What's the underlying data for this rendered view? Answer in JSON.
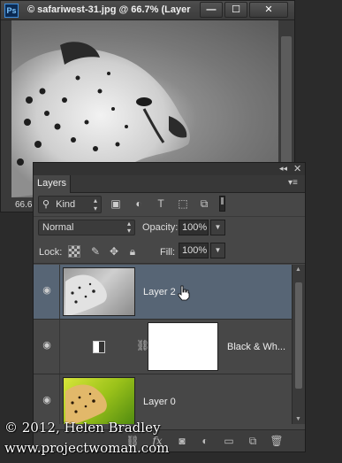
{
  "document": {
    "app_badge": "Ps",
    "title": "© safariwest-31.jpg @ 66.7% (Layer",
    "controls": {
      "minimize": "—",
      "maximize": "☐",
      "close": "✕"
    },
    "zoom_level": "66.6"
  },
  "layers_panel": {
    "tab_label": "Layers",
    "filter": {
      "kind_label": "Kind"
    },
    "blend": {
      "mode": "Normal",
      "opacity_label": "Opacity:",
      "opacity_value": "100%"
    },
    "lock": {
      "label": "Lock:",
      "fill_label": "Fill:",
      "fill_value": "100%"
    },
    "layers": [
      {
        "name": "Layer 2",
        "selected": true,
        "visible": true,
        "thumb": "cheetah-gray"
      },
      {
        "name": "Black & Wh...",
        "selected": false,
        "visible": true,
        "thumb": "adjustment-mask"
      },
      {
        "name": "Layer 0",
        "selected": false,
        "visible": true,
        "thumb": "cheetah-color"
      }
    ],
    "footer_icons": [
      "link-icon",
      "fx-icon",
      "add-mask-icon",
      "adjustment-layer-icon",
      "new-group-icon",
      "new-layer-icon",
      "delete-icon"
    ]
  },
  "watermark": {
    "line1": "© 2012, Helen Bradley",
    "line2": "www.projectwoman.com"
  },
  "colors": {
    "selected_row": "#576575",
    "panel_bg": "#474747"
  }
}
